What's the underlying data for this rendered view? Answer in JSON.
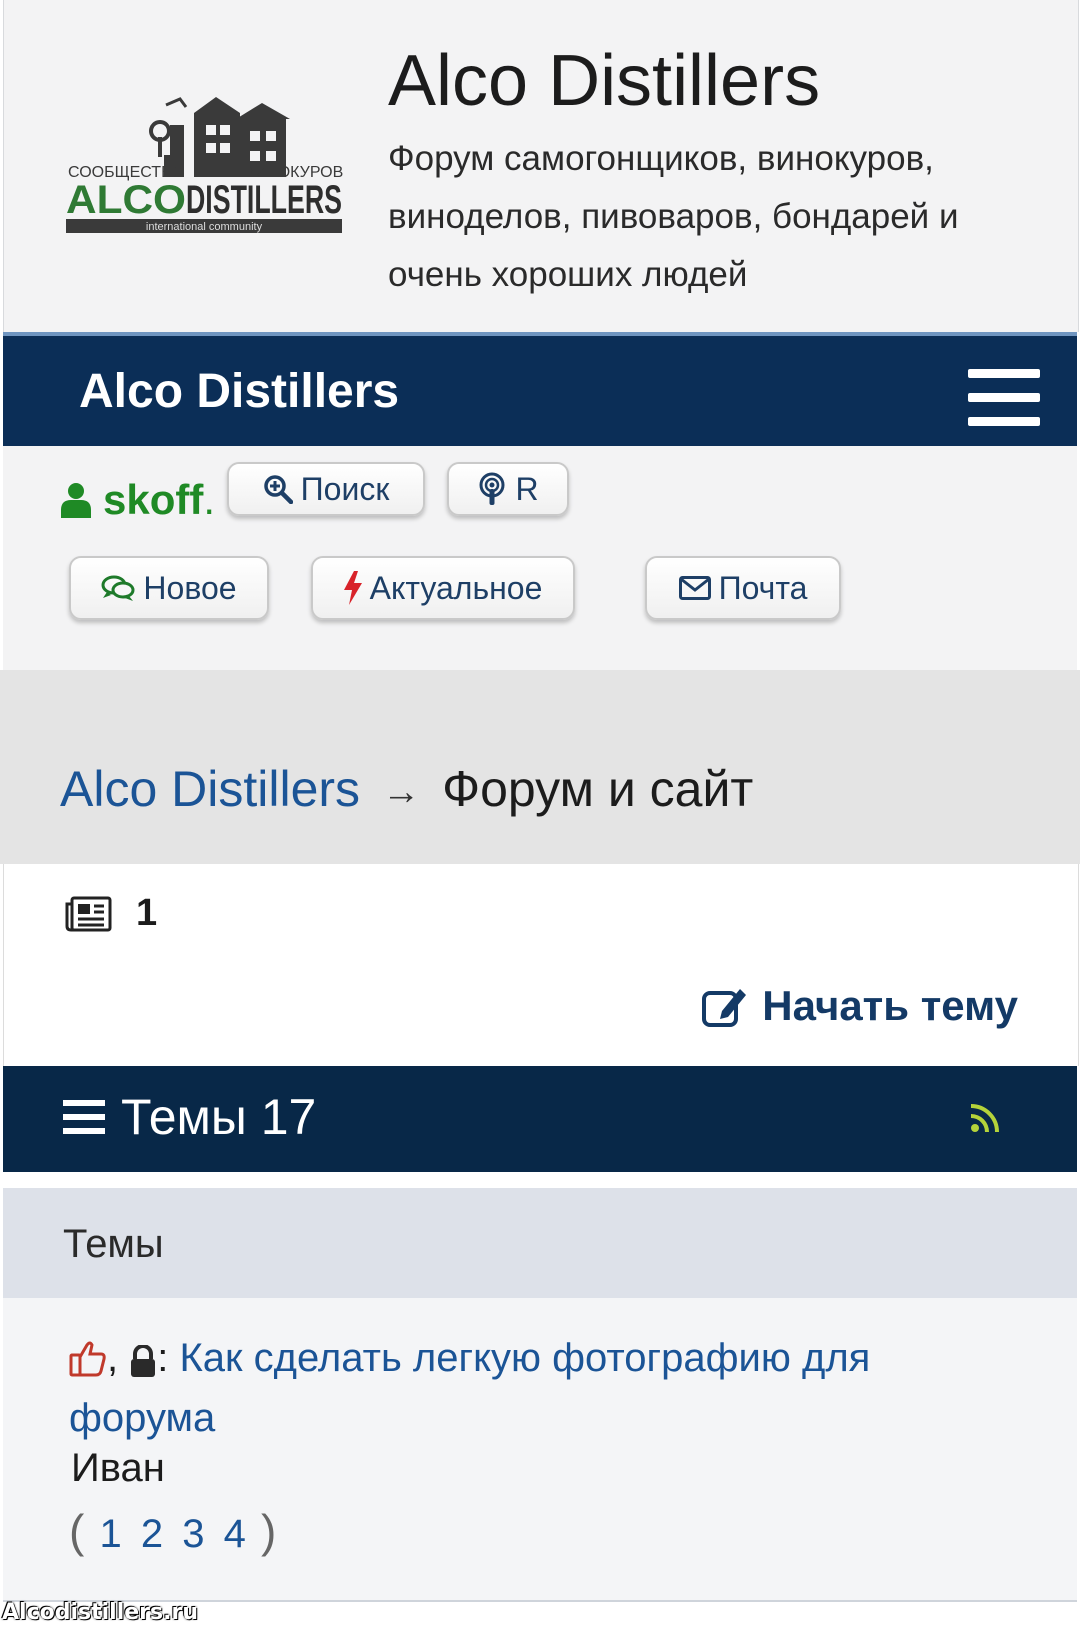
{
  "header": {
    "site_title": "Alco Distillers",
    "description": "Форум самогонщиков, винокуров, виноделов, пивоваров, бондарей и очень хороших людей",
    "logo_text_top_left": "СООБЩЕСТВО",
    "logo_text_top_right": "ВИНОКУРОВ",
    "logo_text_main": "ALCODISTILLERS",
    "logo_text_bottom": "international community"
  },
  "navbar": {
    "brand": "Alco Distillers",
    "menu_icon": "hamburger-icon"
  },
  "userbar": {
    "username": "skoff",
    "username_suffix": ".",
    "buttons": {
      "search": "Поиск",
      "radio": "R",
      "new": "Новое",
      "actual": "Актуальное",
      "mail": "Почта"
    }
  },
  "breadcrumb": {
    "root": "Alco Distillers",
    "arrow": "→",
    "current": "Форум и сайт"
  },
  "info": {
    "count": "1",
    "start_topic": "Начать тему"
  },
  "topics_bar": {
    "title": "Темы 17"
  },
  "table": {
    "column": "Темы",
    "rows": [
      {
        "separator_1": ",",
        "separator_2": ":",
        "title": "Как сделать легкую фотографию для форума",
        "author": "Иван",
        "pages": [
          "1",
          "2",
          "3",
          "4"
        ],
        "paren_open": "(",
        "paren_close": ")"
      }
    ]
  },
  "watermark": "Alcodistillers.ru",
  "colors": {
    "navbar": "#0b2e57",
    "topics_bar": "#082848",
    "link": "#1b5496",
    "user": "#1f8a25",
    "rss": "#b5d33a"
  }
}
